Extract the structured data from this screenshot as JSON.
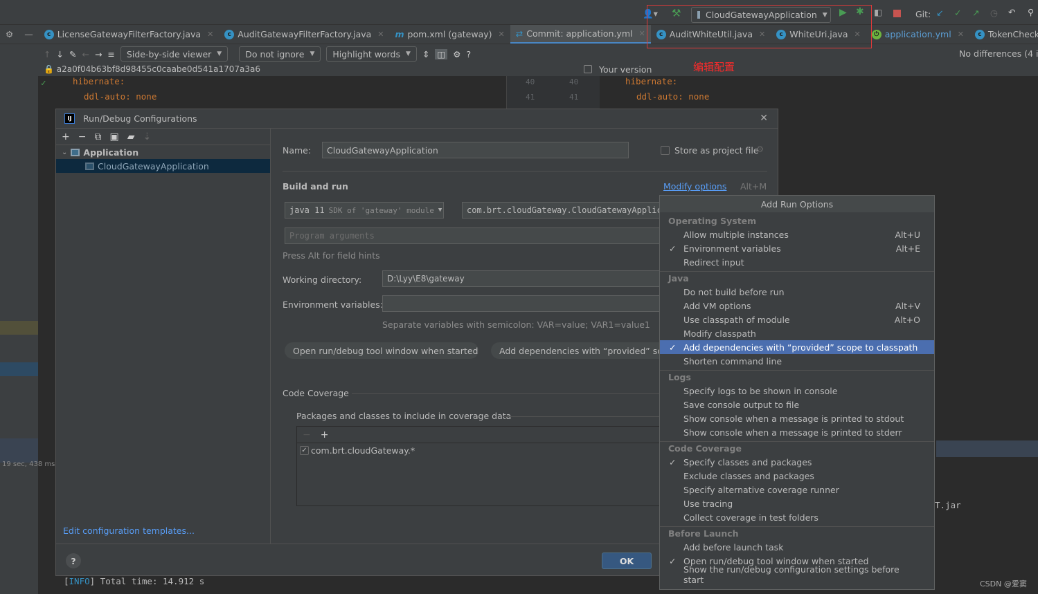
{
  "toolbar": {
    "run_config": "CloudGatewayApplication",
    "git_label": "Git:"
  },
  "tabs": [
    {
      "label": "LicenseGatewayFilterFactory.java",
      "icon": "class-icon"
    },
    {
      "label": "AuditGatewayFilterFactory.java",
      "icon": "class-icon"
    },
    {
      "label": "pom.xml (gateway)",
      "icon": "maven-icon"
    },
    {
      "label": "Commit: application.yml",
      "icon": "diff-icon",
      "active": true
    },
    {
      "label": "AuditWhiteUtil.java",
      "icon": "class-icon"
    },
    {
      "label": "WhiteUri.java",
      "icon": "class-icon"
    },
    {
      "label": "application.yml",
      "icon": "spring-icon"
    },
    {
      "label": "TokenCheckGatewayFilterFactor",
      "icon": "class-icon"
    }
  ],
  "diff": {
    "viewer": "Side-by-side viewer",
    "ignore": "Do not ignore",
    "highlight": "Highlight words",
    "status": "No differences (4 in",
    "revision": "a2a0f04b63bf8d98455c0caabe0d541a1707a3a6",
    "your_version": "Your version",
    "annotation": "编辑配置",
    "left_lines": [
      "hibernate:",
      "ddl-auto: none"
    ],
    "line_numbers": [
      "40",
      "41"
    ],
    "right_lines": [
      "hibernate:",
      "ddl-auto: none"
    ]
  },
  "left_status": "19 sec, 438 ms",
  "dialog": {
    "title": "Run/Debug Configurations",
    "tree": {
      "group": "Application",
      "item": "CloudGatewayApplication"
    },
    "edit_templates": "Edit configuration templates...",
    "name_label": "Name:",
    "name_value": "CloudGatewayApplication",
    "store_label": "Store as project file",
    "build_run": "Build and run",
    "modify_options": "Modify options",
    "modify_shortcut": "Alt+M",
    "jdk": "java 11",
    "jdk_hint": "SDK of 'gateway' module",
    "main_class": "com.brt.cloudGateway.CloudGatewayApplication",
    "program_args_placeholder": "Program arguments",
    "field_hints": "Press Alt for field hints",
    "workdir_label": "Working directory:",
    "workdir_value": "D:\\Lyy\\E8\\gateway",
    "env_label": "Environment variables:",
    "env_value": "",
    "env_hint": "Separate variables with semicolon: VAR=value; VAR1=value1",
    "chips": [
      "Open run/debug tool window when started",
      "Add dependencies with “provided” scope to classpath"
    ],
    "coverage_title": "Code Coverage",
    "coverage_sub": "Packages and classes to include in coverage data",
    "coverage_pattern": "com.brt.cloudGateway.*",
    "ok": "OK"
  },
  "menu": {
    "title": "Add Run Options",
    "sections": [
      {
        "name": "Operating System",
        "items": [
          {
            "label": "Allow multiple instances",
            "shortcut": "Alt+U"
          },
          {
            "label": "Environment variables",
            "shortcut": "Alt+E",
            "checked": true
          },
          {
            "label": "Redirect input"
          }
        ]
      },
      {
        "name": "Java",
        "items": [
          {
            "label": "Do not build before run"
          },
          {
            "label": "Add VM options",
            "shortcut": "Alt+V"
          },
          {
            "label": "Use classpath of module",
            "shortcut": "Alt+O"
          },
          {
            "label": "Modify classpath"
          },
          {
            "label": "Add dependencies with “provided” scope to classpath",
            "checked": true,
            "selected": true
          },
          {
            "label": "Shorten command line"
          }
        ]
      },
      {
        "name": "Logs",
        "items": [
          {
            "label": "Specify logs to be shown in console"
          },
          {
            "label": "Save console output to file"
          },
          {
            "label": "Show console when a message is printed to stdout"
          },
          {
            "label": "Show console when a message is printed to stderr"
          }
        ]
      },
      {
        "name": "Code Coverage",
        "items": [
          {
            "label": "Specify classes and packages",
            "checked": true
          },
          {
            "label": "Exclude classes and packages"
          },
          {
            "label": "Specify alternative coverage runner"
          },
          {
            "label": "Use tracing"
          },
          {
            "label": "Collect coverage in test folders"
          }
        ]
      },
      {
        "name": "Before Launch",
        "items": [
          {
            "label": "Add before launch task"
          },
          {
            "label": "Open run/debug tool window when started",
            "checked": true
          },
          {
            "label": "Show the run/debug configuration settings before start"
          }
        ]
      }
    ]
  },
  "console": {
    "line1_tag": "INFO",
    "line1_text": "Total time:  14.912 s",
    "right_fragment": "T.jar"
  },
  "watermark": "CSDN @爱窦"
}
